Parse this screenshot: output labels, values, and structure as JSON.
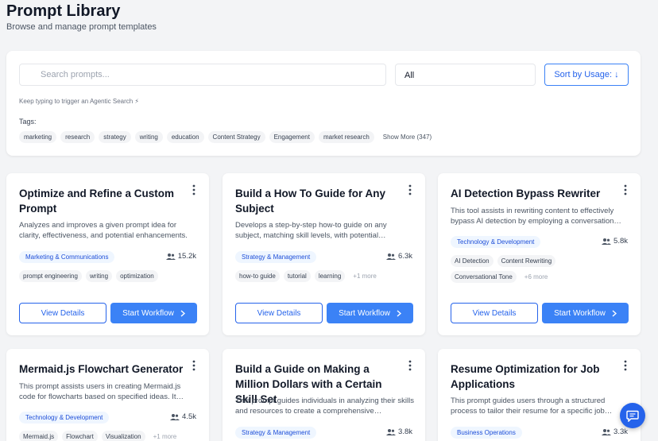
{
  "header": {
    "title": "Prompt Library",
    "subtitle": "Browse and manage prompt templates"
  },
  "filters": {
    "search_placeholder": "Search prompts...",
    "category_value": "All",
    "sort_label": "Sort by Usage: ↓",
    "hint": "Keep typing to trigger an Agentic Search ⚡",
    "tags_label": "Tags:",
    "tags": [
      "marketing",
      "research",
      "strategy",
      "writing",
      "education",
      "Content Strategy",
      "Engagement",
      "market research"
    ],
    "show_more": "Show More (347)"
  },
  "card_actions": {
    "view_label": "View Details",
    "start_label": "Start Workflow"
  },
  "cards": [
    {
      "title": "Optimize and Refine a Custom Prompt",
      "description": "Analyzes and improves a given prompt idea for clarity, effectiveness, and potential enhancements.",
      "category": "Marketing & Communications",
      "usage": "15.2k",
      "tags": [
        "prompt engineering",
        "writing",
        "optimization"
      ],
      "more": ""
    },
    {
      "title": "Build a How To Guide for Any Subject",
      "description": "Develops a step-by-step how-to guide on any subject, matching skill levels, with potential…",
      "category": "Strategy & Management",
      "usage": "6.3k",
      "tags": [
        "how-to guide",
        "tutorial",
        "learning"
      ],
      "more": "+1 more"
    },
    {
      "title": "AI Detection Bypass Rewriter",
      "description": "This tool assists in rewriting content to effectively bypass AI detection by employing a conversation…",
      "category": "Technology & Development",
      "usage": "5.8k",
      "tags": [
        "AI Detection",
        "Content Rewriting",
        "Conversational Tone"
      ],
      "more": "+6 more"
    },
    {
      "title": "Mermaid.js Flowchart Generator",
      "description": "This prompt assists users in creating Mermaid.js code for flowcharts based on specified ideas. It…",
      "category": "Technology & Development",
      "usage": "4.5k",
      "tags": [
        "Mermaid.js",
        "Flowchart",
        "Visualization"
      ],
      "more": "+1 more"
    },
    {
      "title": "Build a Guide on Making a Million Dollars with a Certain Skill Set",
      "description": "This prompt guides individuals in analyzing their skills and resources to create a comprehensive…",
      "category": "Strategy & Management",
      "usage": "3.8k",
      "tags": [],
      "more": ""
    },
    {
      "title": "Resume Optimization for Job Applications",
      "description": "This prompt guides users through a structured process to tailor their resume for a specific job…",
      "category": "Business Operations",
      "usage": "3.3k",
      "tags": [],
      "more": ""
    }
  ],
  "icons": {
    "search": "search-icon",
    "menu": "more-vertical-icon",
    "users": "users-icon",
    "chevron": "chevron-right-icon",
    "chat": "chat-icon"
  },
  "colors": {
    "accent": "#3b82f6",
    "accent_dark": "#2563eb",
    "badge_bg": "#eff6ff",
    "page_bg": "#f3f4f6"
  }
}
